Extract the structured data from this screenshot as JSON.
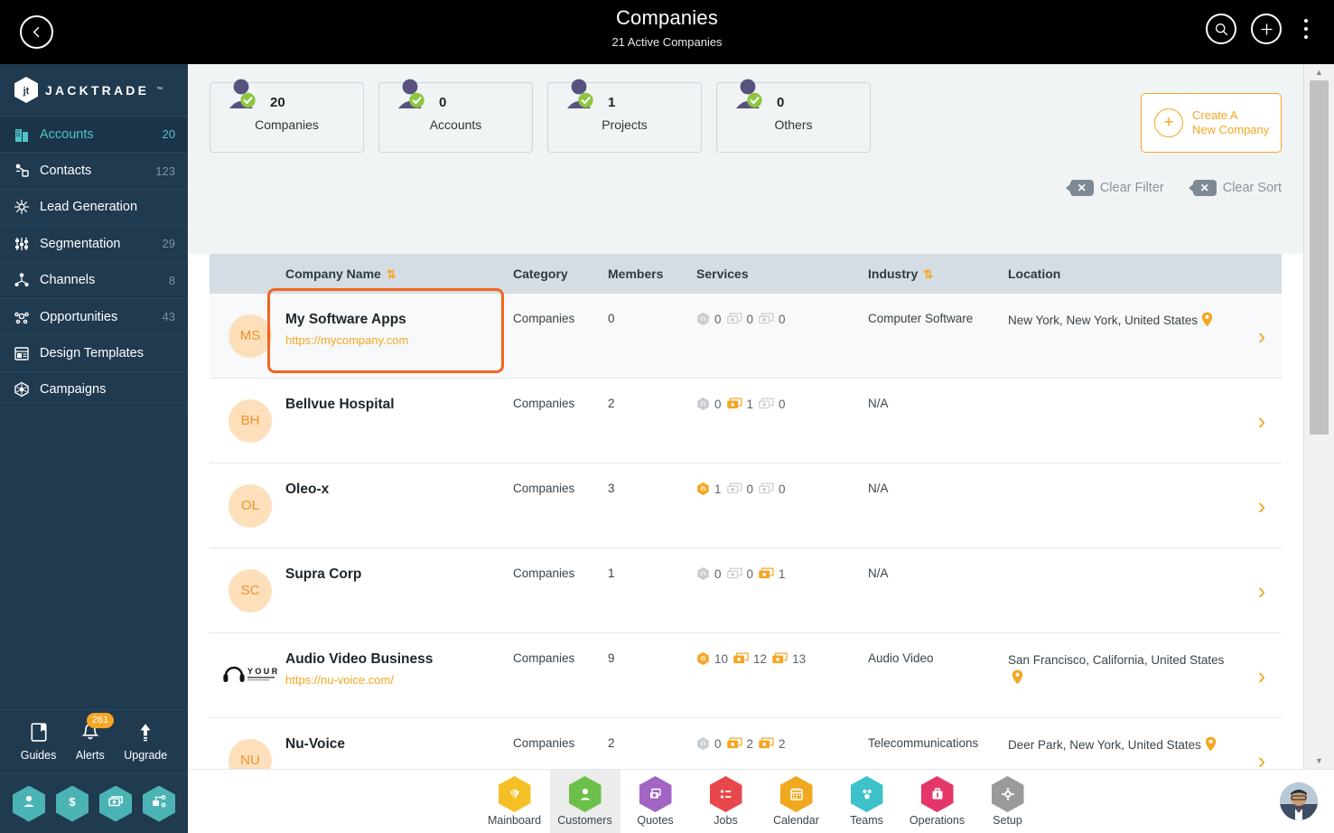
{
  "header": {
    "title": "Companies",
    "subtitle": "21 Active Companies",
    "back_icon": "chevron-left-icon",
    "search_icon": "search-icon",
    "add_icon": "plus-icon",
    "menu_icon": "kebab-menu-icon"
  },
  "brand": {
    "name": "JACKTRADE",
    "tm": "™"
  },
  "sidebar": {
    "items": [
      {
        "label": "Accounts",
        "count": "20",
        "icon": "building-icon",
        "active": true
      },
      {
        "label": "Contacts",
        "count": "123",
        "icon": "contacts-icon",
        "active": false
      },
      {
        "label": "Lead Generation",
        "count": "",
        "icon": "lead-gen-icon",
        "active": false
      },
      {
        "label": "Segmentation",
        "count": "29",
        "icon": "segment-icon",
        "active": false
      },
      {
        "label": "Channels",
        "count": "8",
        "icon": "channels-icon",
        "active": false
      },
      {
        "label": "Opportunities",
        "count": "43",
        "icon": "opportunity-icon",
        "active": false
      },
      {
        "label": "Design Templates",
        "count": "",
        "icon": "template-icon",
        "active": false
      },
      {
        "label": "Campaigns",
        "count": "",
        "icon": "campaign-icon",
        "active": false
      }
    ],
    "tools": [
      {
        "label": "Guides",
        "icon": "book-icon",
        "badge": ""
      },
      {
        "label": "Alerts",
        "icon": "bell-icon",
        "badge": "261"
      },
      {
        "label": "Upgrade",
        "icon": "arrow-up-icon",
        "badge": ""
      }
    ],
    "quick_hexes": [
      {
        "icon": "person-icon"
      },
      {
        "icon": "dollar-icon"
      },
      {
        "icon": "money-icon"
      },
      {
        "icon": "workflow-icon"
      }
    ]
  },
  "stats": [
    {
      "value": "20",
      "label": "Companies"
    },
    {
      "value": "0",
      "label": "Accounts"
    },
    {
      "value": "1",
      "label": "Projects"
    },
    {
      "value": "0",
      "label": "Others"
    }
  ],
  "create_button": {
    "line1": "Create A",
    "line2": "New Company",
    "icon": "plus-circle-icon"
  },
  "filters": [
    {
      "label": "Clear Filter",
      "icon": "clear-x-icon"
    },
    {
      "label": "Clear Sort",
      "icon": "clear-x-icon"
    }
  ],
  "table": {
    "columns": [
      {
        "key": "name",
        "label": "Company Name",
        "sortable": true
      },
      {
        "key": "category",
        "label": "Category",
        "sortable": false
      },
      {
        "key": "members",
        "label": "Members",
        "sortable": false
      },
      {
        "key": "services",
        "label": "Services",
        "sortable": false
      },
      {
        "key": "industry",
        "label": "Industry",
        "sortable": true
      },
      {
        "key": "location",
        "label": "Location",
        "sortable": false
      }
    ],
    "sort_icon": "sort-arrows-icon",
    "rows": [
      {
        "initials": "MS",
        "logo_type": "initials",
        "name": "My Software Apps",
        "url": "https://mycompany.com",
        "category": "Companies",
        "members": "0",
        "services": [
          {
            "icon": "badge-icon",
            "value": "0",
            "on": false
          },
          {
            "icon": "card-icon",
            "value": "0",
            "on": false
          },
          {
            "icon": "card-icon",
            "value": "0",
            "on": false
          }
        ],
        "industry": "Computer Software",
        "location": "New York, New York, United States",
        "has_pin": true,
        "highlighted": true
      },
      {
        "initials": "BH",
        "logo_type": "initials",
        "name": "Bellvue Hospital",
        "url": "",
        "category": "Companies",
        "members": "2",
        "services": [
          {
            "icon": "badge-icon",
            "value": "0",
            "on": false
          },
          {
            "icon": "card-icon",
            "value": "1",
            "on": true
          },
          {
            "icon": "card-icon",
            "value": "0",
            "on": false
          }
        ],
        "industry": "N/A",
        "location": "",
        "has_pin": false,
        "highlighted": false
      },
      {
        "initials": "OL",
        "logo_type": "initials",
        "name": "Oleo-x",
        "url": "",
        "category": "Companies",
        "members": "3",
        "services": [
          {
            "icon": "badge-icon",
            "value": "1",
            "on": true
          },
          {
            "icon": "card-icon",
            "value": "0",
            "on": false
          },
          {
            "icon": "card-icon",
            "value": "0",
            "on": false
          }
        ],
        "industry": "N/A",
        "location": "",
        "has_pin": false,
        "highlighted": false
      },
      {
        "initials": "SC",
        "logo_type": "initials",
        "name": "Supra Corp",
        "url": "",
        "category": "Companies",
        "members": "1",
        "services": [
          {
            "icon": "badge-icon",
            "value": "0",
            "on": false
          },
          {
            "icon": "card-icon",
            "value": "0",
            "on": false
          },
          {
            "icon": "card-icon",
            "value": "1",
            "on": true
          }
        ],
        "industry": "N/A",
        "location": "",
        "has_pin": false,
        "highlighted": false
      },
      {
        "initials": "",
        "logo_type": "image",
        "logo_text": "YOUR",
        "name": "Audio Video Business",
        "url": "https://nu-voice.com/",
        "category": "Companies",
        "members": "9",
        "services": [
          {
            "icon": "badge-icon",
            "value": "10",
            "on": true
          },
          {
            "icon": "card-icon",
            "value": "12",
            "on": true
          },
          {
            "icon": "card-icon",
            "value": "13",
            "on": true
          }
        ],
        "industry": "Audio Video",
        "location": "San Francisco, California, United States",
        "has_pin": true,
        "highlighted": false
      },
      {
        "initials": "NU",
        "logo_type": "initials",
        "name": "Nu-Voice",
        "url": "",
        "category": "Companies",
        "members": "2",
        "services": [
          {
            "icon": "badge-icon",
            "value": "0",
            "on": false
          },
          {
            "icon": "card-icon",
            "value": "2",
            "on": true
          },
          {
            "icon": "card-icon",
            "value": "2",
            "on": true
          }
        ],
        "industry": "Telecommunications",
        "location": "Deer Park, New York, United States",
        "has_pin": true,
        "highlighted": false
      }
    ]
  },
  "bottom_nav": [
    {
      "label": "Mainboard",
      "icon": "mainboard-icon",
      "color": "#f5c026",
      "active": false
    },
    {
      "label": "Customers",
      "icon": "customers-icon",
      "color": "#6cc04a",
      "active": true
    },
    {
      "label": "Quotes",
      "icon": "quotes-icon",
      "color": "#a265c4",
      "active": false
    },
    {
      "label": "Jobs",
      "icon": "jobs-icon",
      "color": "#e8474c",
      "active": false
    },
    {
      "label": "Calendar",
      "icon": "calendar-icon",
      "color": "#f0a81e",
      "active": false
    },
    {
      "label": "Teams",
      "icon": "teams-icon",
      "color": "#3fc1c9",
      "active": false
    },
    {
      "label": "Operations",
      "icon": "operations-icon",
      "color": "#e5366a",
      "active": false
    },
    {
      "label": "Setup",
      "icon": "setup-icon",
      "color": "#9a9a9a",
      "active": false
    }
  ],
  "colors": {
    "accent_orange": "#f5a623",
    "highlight_orange": "#f4641e",
    "sidebar_bg": "#203a4f",
    "sidebar_active_text": "#4ec4c4",
    "table_header_bg": "#d4dde3",
    "panel_bg": "#f1f4f5",
    "person_purple": "#57527e",
    "check_green": "#8dc63f"
  },
  "user": {
    "avatar": "user-avatar"
  },
  "scrollbar": {
    "up_icon": "caret-up-icon",
    "down_icon": "caret-down-icon"
  }
}
